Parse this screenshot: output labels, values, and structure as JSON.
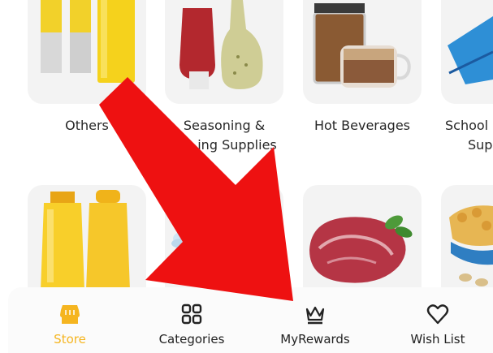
{
  "categories_row1": [
    {
      "label_line1": "Others",
      "label_line2": "",
      "icon": "batteries-image"
    },
    {
      "label_line1": "Seasoning &",
      "label_line2": "ing Supplies",
      "icon": "sauce-bottles-image"
    },
    {
      "label_line1": "Hot Beverages",
      "label_line2": "",
      "icon": "coffee-image"
    },
    {
      "label_line1": "School",
      "label_line2": "Sup",
      "icon": "notebook-image"
    }
  ],
  "categories_row2": [
    {
      "icon": "shampoo-bottles-image"
    },
    {
      "icon": "cleaning-image"
    },
    {
      "icon": "meat-image"
    },
    {
      "icon": "cereal-image"
    }
  ],
  "bottom_nav": {
    "items": [
      {
        "label": "Store",
        "icon": "store-icon",
        "active": true
      },
      {
        "label": "Categories",
        "icon": "grid-icon",
        "active": false
      },
      {
        "label": "MyRewards",
        "icon": "crown-icon",
        "active": false
      },
      {
        "label": "Wish List",
        "icon": "heart-icon",
        "active": false
      }
    ]
  },
  "colors": {
    "accent": "#f5b520",
    "arrow": "#ee1111",
    "tile_bg": "#f3f3f3"
  }
}
